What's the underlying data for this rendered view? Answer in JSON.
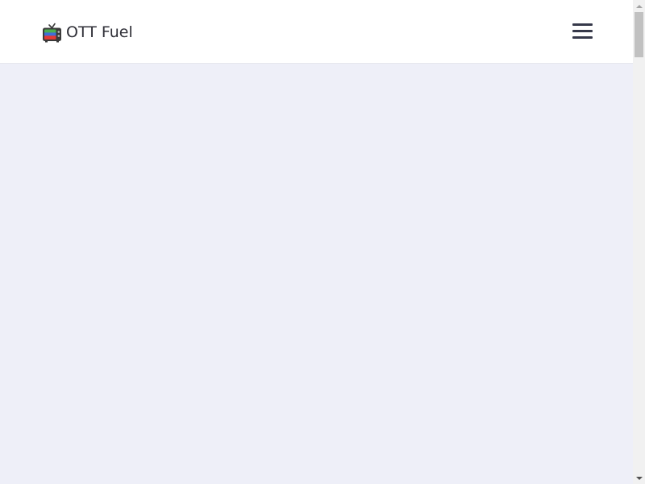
{
  "header": {
    "brand_name": "OTT Fuel",
    "logo_icon": "retro-tv-icon",
    "menu_icon": "hamburger-menu-icon"
  },
  "colors": {
    "page_background": "#eeeff8",
    "navbar_background": "#ffffff",
    "brand_text": "#2f2f37",
    "menu_icon": "#36394a",
    "tv_body": "#3a3a3a",
    "tv_screen_top": "#4caf50",
    "tv_screen_middle": "#3f6fd8",
    "tv_screen_bottom": "#e53935"
  },
  "scrollbar": {
    "up_icon": "scroll-up-arrow-icon",
    "down_icon": "scroll-down-arrow-icon"
  }
}
